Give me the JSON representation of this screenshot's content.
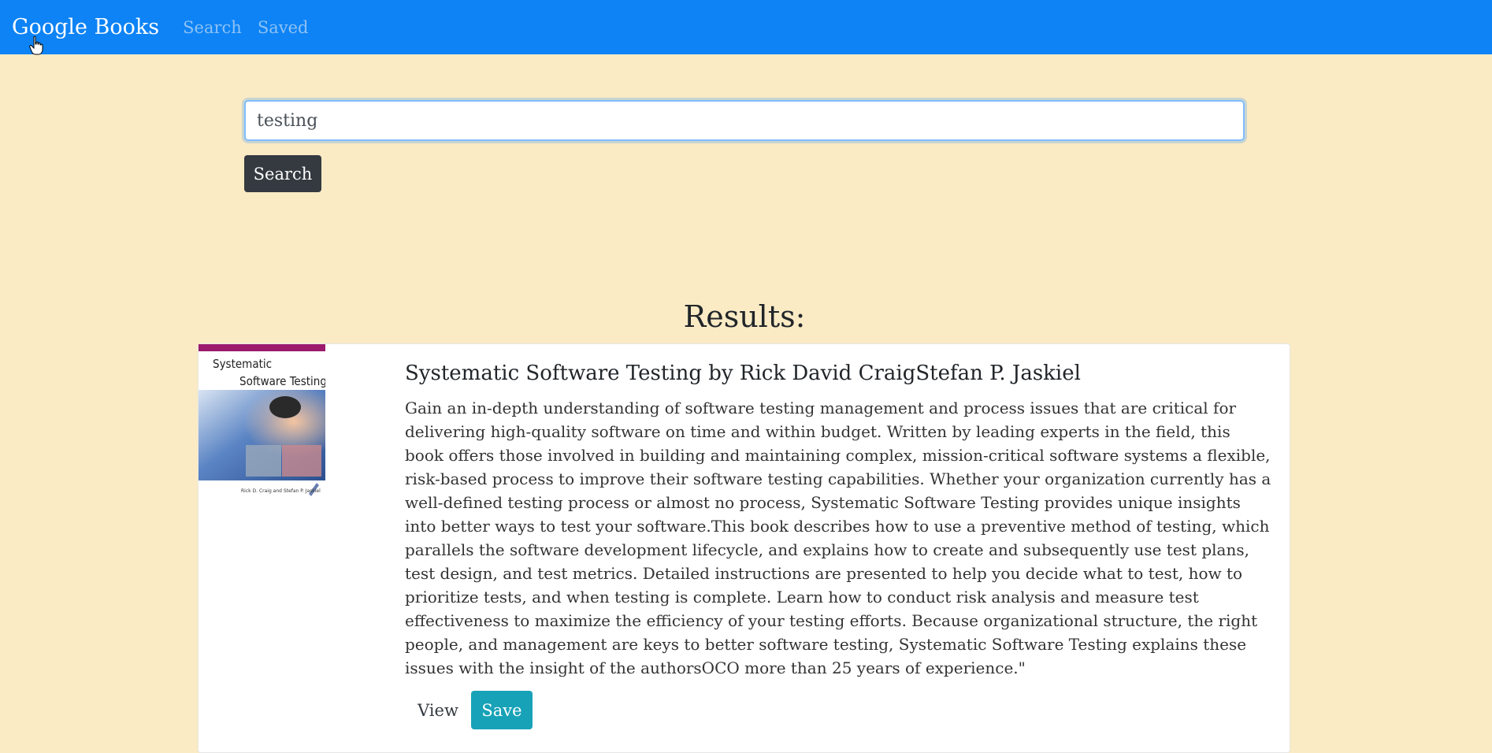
{
  "navbar": {
    "brand": "Google Books",
    "links": [
      "Search",
      "Saved"
    ]
  },
  "search": {
    "value": "testing",
    "button_label": "Search"
  },
  "results": {
    "heading": "Results:",
    "items": [
      {
        "title": "Systematic Software Testing by Rick David CraigStefan P. Jaskiel",
        "cover_title_line1": "Systematic",
        "cover_title_line2": "Software Testing",
        "cover_authors": "Rick D. Craig and Stefan P. Jaskiel",
        "description": "Gain an in-depth understanding of software testing management and process issues that are critical for delivering high-quality software on time and within budget. Written by leading experts in the field, this book offers those involved in building and maintaining complex, mission-critical software systems a flexible, risk-based process to improve their software testing capabilities. Whether your organization currently has a well-defined testing process or almost no process, Systematic Software Testing provides unique insights into better ways to test your software.This book describes how to use a preventive method of testing, which parallels the software development lifecycle, and explains how to create and subsequently use test plans, test design, and test metrics. Detailed instructions are presented to help you decide what to test, how to prioritize tests, and when testing is complete. Learn how to conduct risk analysis and measure test effectiveness to maximize the efficiency of your testing efforts. Because organizational structure, the right people, and management are keys to better software testing, Systematic Software Testing explains these issues with the insight of the authorsOCO more than 25 years of experience.\"",
        "view_label": "View",
        "save_label": "Save"
      }
    ]
  },
  "colors": {
    "navbar_bg": "#0d83f5",
    "page_bg": "#faebc5",
    "search_button": "#343a40",
    "save_button": "#17a2b8"
  }
}
